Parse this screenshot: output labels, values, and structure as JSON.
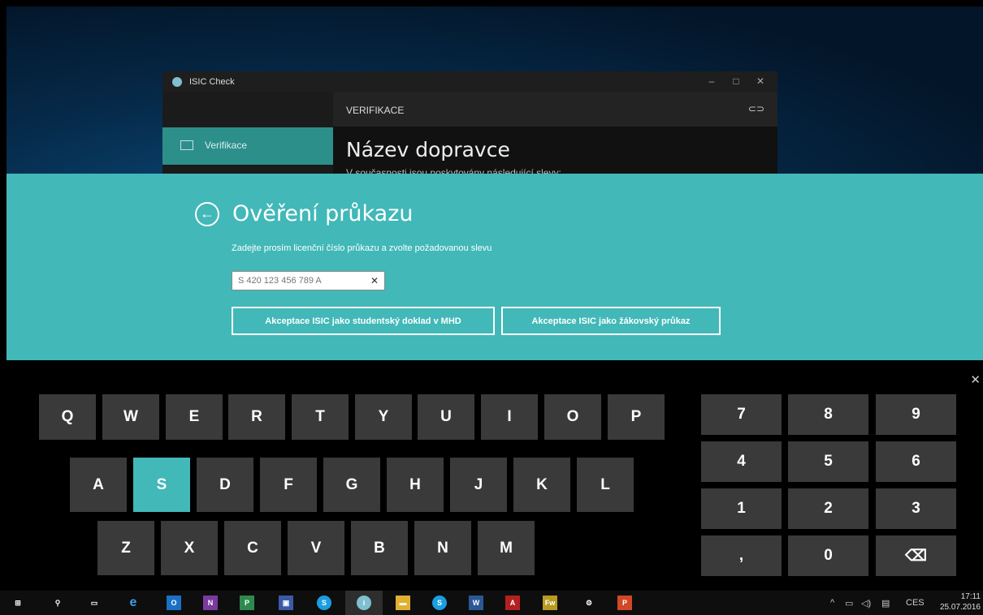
{
  "window": {
    "title": "ISIC Check",
    "controls": [
      "–",
      "□",
      "✕"
    ],
    "header": "VERIFIKACE",
    "link_icon": "link-icon",
    "nav_label": "Verifikace",
    "heading": "Název dopravce",
    "subtext": "V současnosti jsou poskytovány následující slevy:"
  },
  "dialog": {
    "back_icon": "back-arrow-icon",
    "title": "Ověření průkazu",
    "instruction": "Zadejte prosím licenční číslo průkazu a zvolte požadovanou slevu",
    "input_placeholder": "S 420 123 456 789 A",
    "clear_label": "✕",
    "button1": "Akceptace ISIC jako studentský doklad v MHD",
    "button2": "Akceptace ISIC jako žákovský průkaz",
    "accent_color": "#42b8b8"
  },
  "keyboard": {
    "close": "✕",
    "row1": [
      "Q",
      "W",
      "E",
      "R",
      "T",
      "Y",
      "U",
      "I",
      "O",
      "P"
    ],
    "row2": [
      "A",
      "S",
      "D",
      "F",
      "G",
      "H",
      "J",
      "K",
      "L"
    ],
    "row3": [
      "Z",
      "X",
      "C",
      "V",
      "B",
      "N",
      "M"
    ],
    "active_key": "S",
    "numpad": [
      "7",
      "8",
      "9",
      "4",
      "5",
      "6",
      "1",
      "2",
      "3",
      ",",
      "0",
      "⌫"
    ]
  },
  "taskbar": {
    "icons": [
      "windows-start-icon",
      "search-icon",
      "task-view-icon",
      "edge-icon",
      "outlook-icon",
      "onenote-icon",
      "project-icon",
      "save-icon",
      "skype-icon",
      "isic-icon",
      "file-explorer-icon",
      "skype-business-icon",
      "word-icon",
      "acrobat-icon",
      "fireworks-icon",
      "settings-icon",
      "powerpoint-icon"
    ],
    "tray": {
      "language": "CES",
      "time": "17:11",
      "date": "25.07.2016"
    }
  }
}
